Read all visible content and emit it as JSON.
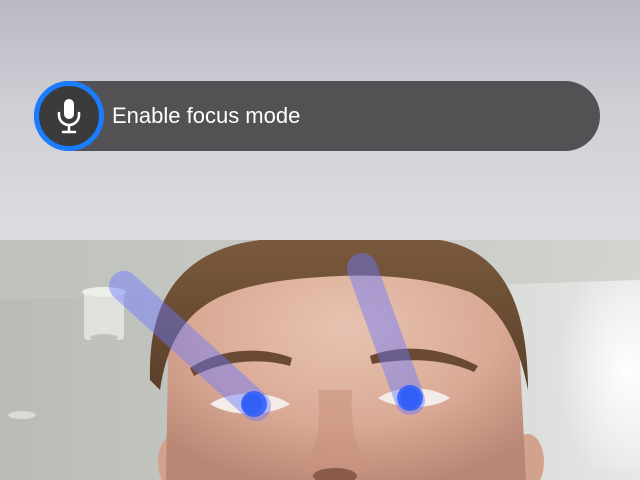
{
  "voice_prompt": {
    "label": "Enable focus mode",
    "icon": "microphone-icon",
    "accent_color": "#1a7cff"
  },
  "camera": {
    "gaze_indicator_color": "#2a5cff"
  }
}
